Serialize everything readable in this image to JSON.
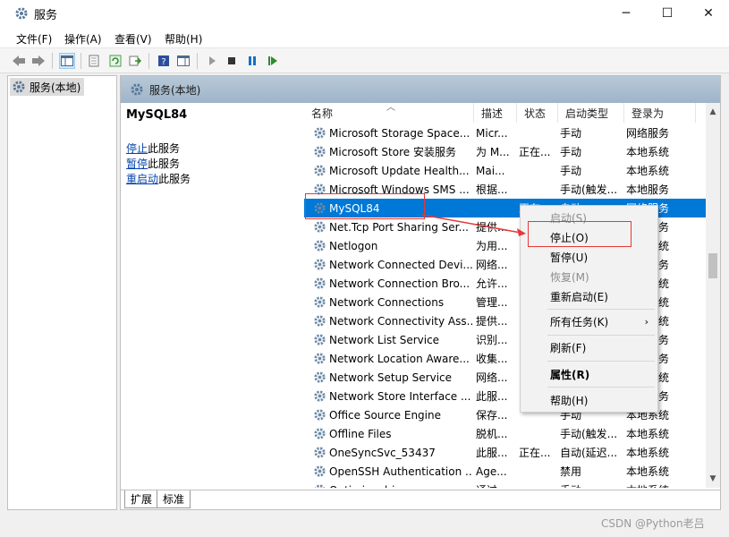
{
  "window": {
    "title": "服务"
  },
  "menu": [
    "文件(F)",
    "操作(A)",
    "查看(V)",
    "帮助(H)"
  ],
  "tree": {
    "root_label": "服务(本地)"
  },
  "main": {
    "header": "服务(本地)"
  },
  "detail": {
    "service_name": "MySQL84",
    "links": [
      {
        "link": "停止",
        "suffix": "此服务"
      },
      {
        "link": "暂停",
        "suffix": "此服务"
      },
      {
        "link": "重启动",
        "suffix": "此服务"
      }
    ]
  },
  "table": {
    "columns": [
      "名称",
      "描述",
      "状态",
      "启动类型",
      "登录为"
    ],
    "rows": [
      {
        "name": "Microsoft Storage Space...",
        "desc": "Micr...",
        "status": "",
        "start": "手动",
        "login": "网络服务"
      },
      {
        "name": "Microsoft Store 安装服务",
        "desc": "为 M...",
        "status": "正在...",
        "start": "手动",
        "login": "本地系统"
      },
      {
        "name": "Microsoft Update Health...",
        "desc": "Mai...",
        "status": "",
        "start": "手动",
        "login": "本地系统"
      },
      {
        "name": "Microsoft Windows SMS ...",
        "desc": "根据...",
        "status": "",
        "start": "手动(触发...",
        "login": "本地服务"
      },
      {
        "name": "MySQL84",
        "desc": "",
        "status": "正在...",
        "start": "自动",
        "login": "网络服务"
      },
      {
        "name": "Net.Tcp Port Sharing Ser...",
        "desc": "提供...",
        "status": "",
        "start": "",
        "login": "本地服务"
      },
      {
        "name": "Netlogon",
        "desc": "为用...",
        "status": "",
        "start": "",
        "login": "本地系统"
      },
      {
        "name": "Network Connected Devi...",
        "desc": "网络...",
        "status": "",
        "start": "",
        "login": "本地服务"
      },
      {
        "name": "Network Connection Bro...",
        "desc": "允许...",
        "status": "",
        "start": "",
        "login": "本地系统"
      },
      {
        "name": "Network Connections",
        "desc": "管理...",
        "status": "",
        "start": "",
        "login": "本地系统"
      },
      {
        "name": "Network Connectivity Ass...",
        "desc": "提供...",
        "status": "",
        "start": "",
        "login": "本地系统"
      },
      {
        "name": "Network List Service",
        "desc": "识别...",
        "status": "",
        "start": "",
        "login": "本地服务"
      },
      {
        "name": "Network Location Aware...",
        "desc": "收集...",
        "status": "",
        "start": "",
        "login": "网络服务"
      },
      {
        "name": "Network Setup Service",
        "desc": "网络...",
        "status": "",
        "start": "",
        "login": "本地系统"
      },
      {
        "name": "Network Store Interface ...",
        "desc": "此服...",
        "status": "",
        "start": "",
        "login": "本地服务"
      },
      {
        "name": "Office Source Engine",
        "desc": "保存...",
        "status": "",
        "start": "手动",
        "login": "本地系统"
      },
      {
        "name": "Offline Files",
        "desc": "脱机...",
        "status": "",
        "start": "手动(触发...",
        "login": "本地系统"
      },
      {
        "name": "OneSyncSvc_53437",
        "desc": "此服...",
        "status": "正在...",
        "start": "自动(延迟...",
        "login": "本地系统"
      },
      {
        "name": "OpenSSH Authentication ...",
        "desc": "Age...",
        "status": "",
        "start": "禁用",
        "login": "本地系统"
      },
      {
        "name": "Optimize drives",
        "desc": "通过...",
        "status": "",
        "start": "手动",
        "login": "本地系统"
      }
    ]
  },
  "context_menu": {
    "items": [
      "启动(S)",
      "停止(O)",
      "暂停(U)",
      "恢复(M)",
      "重新启动(E)",
      "所有任务(K)",
      "刷新(F)",
      "属性(R)",
      "帮助(H)"
    ]
  },
  "tabs": [
    "扩展",
    "标准"
  ],
  "watermark": "CSDN @Python老吕",
  "colors": {
    "selection": "#0078d7",
    "highlight": "#e53935",
    "link": "#0645ad"
  }
}
